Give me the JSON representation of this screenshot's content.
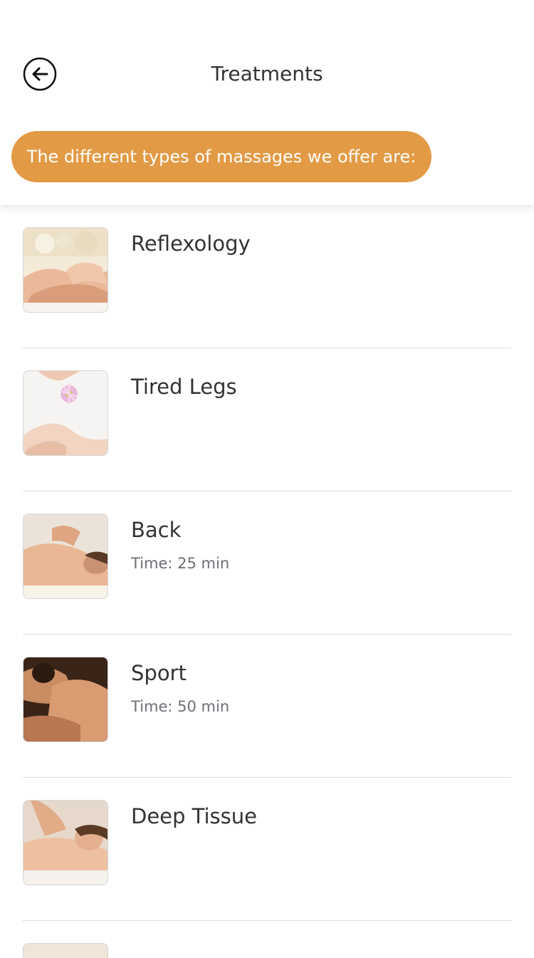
{
  "status_bar": {
    "battery_color": "#5cb85c"
  },
  "header": {
    "title": "Treatments",
    "back_icon": "arrow-left-circle-icon"
  },
  "banner": {
    "text": "The different types of massages we offer are:",
    "color": "#e39a45"
  },
  "treatments": [
    {
      "name": "Reflexology",
      "time": ""
    },
    {
      "name": "Tired Legs",
      "time": ""
    },
    {
      "name": "Back",
      "time": "Time: 25 min"
    },
    {
      "name": "Sport",
      "time": "Time: 50 min"
    },
    {
      "name": "Deep Tissue",
      "time": ""
    }
  ]
}
